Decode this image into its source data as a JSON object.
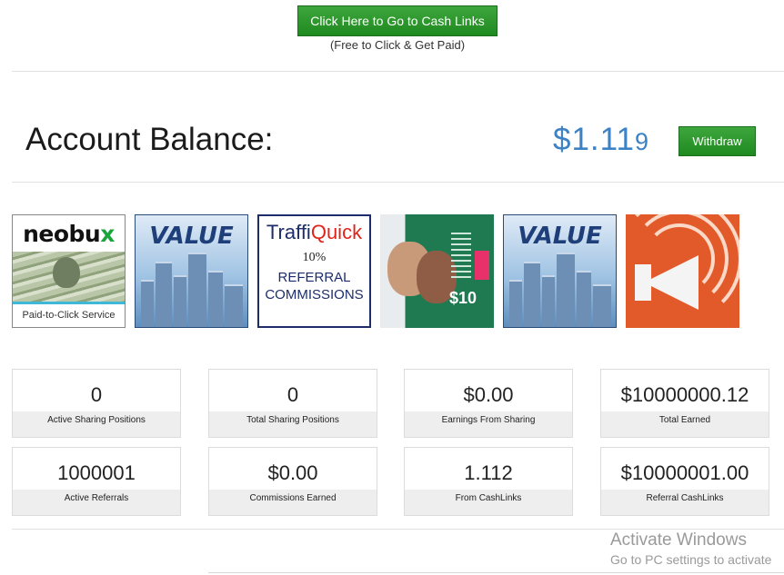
{
  "top": {
    "cash_button_label": "Click Here to Go to Cash Links",
    "cash_button_subtitle": "(Free to Click & Get Paid)"
  },
  "balance": {
    "label": "Account Balance:",
    "value_main": "$1.11",
    "value_last_digit": "9",
    "value_color": "#3d82c4",
    "withdraw_label": "Withdraw"
  },
  "ads": [
    {
      "name": "neobux",
      "brand_main": "neobu",
      "brand_x": "x",
      "caption": "Paid-to-Click Service"
    },
    {
      "name": "value",
      "title": "VALUE"
    },
    {
      "name": "traffiquick",
      "brand_main": "Traffi",
      "brand_accent": "Quick",
      "percent": "10%",
      "line1": "REFERRAL",
      "line2": "COMMISSIONS"
    },
    {
      "name": "people-ad",
      "amount": "$10"
    },
    {
      "name": "value",
      "title": "VALUE"
    },
    {
      "name": "megaphone-ad"
    }
  ],
  "stats": [
    {
      "value": "0",
      "label": "Active Sharing Positions"
    },
    {
      "value": "0",
      "label": "Total Sharing Positions"
    },
    {
      "value": "$0.00",
      "label": "Earnings From Sharing"
    },
    {
      "value": "$10000000.12",
      "label": "Total Earned"
    },
    {
      "value": "1000001",
      "label": "Active Referrals"
    },
    {
      "value": "$0.00",
      "label": "Commissions Earned"
    },
    {
      "value": "1.112",
      "label": "From CashLinks"
    },
    {
      "value": "$10000001.00",
      "label": "Referral CashLinks"
    }
  ],
  "watermark": {
    "title": "Activate Windows",
    "subtitle": "Go to PC settings to activate"
  },
  "colors": {
    "button_green": "#229022",
    "accent_blue": "#3d82c4"
  }
}
